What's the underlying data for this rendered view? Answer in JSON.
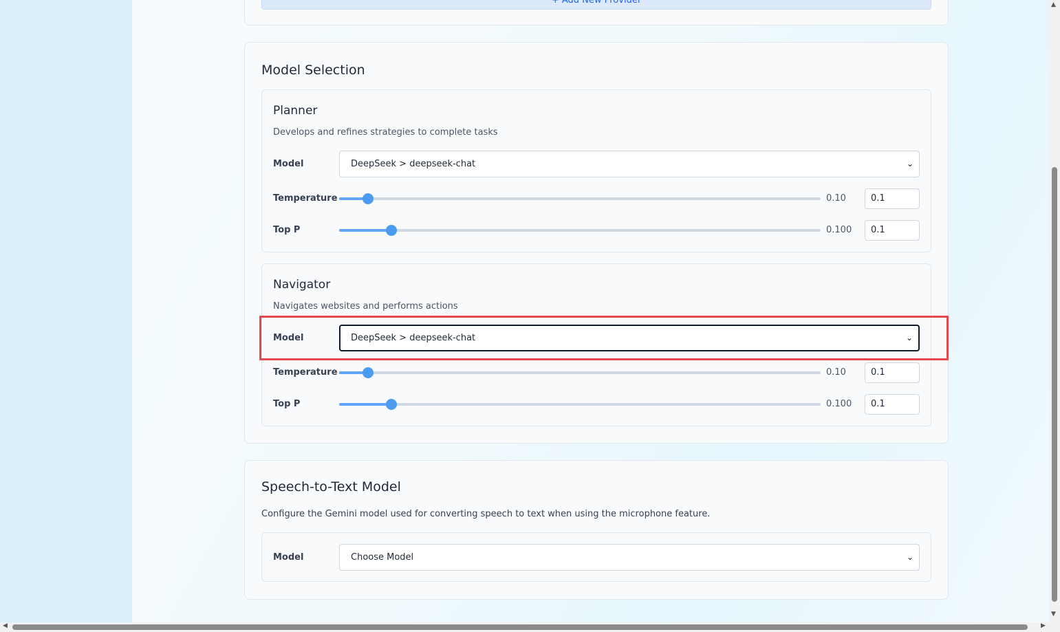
{
  "providers": {
    "add_button_label": "+ Add New Provider"
  },
  "model_selection": {
    "title": "Model Selection",
    "agents": [
      {
        "title": "Planner",
        "description": "Develops and refines strategies to complete tasks",
        "model_label": "Model",
        "model_value": "DeepSeek > deepseek-chat",
        "temperature": {
          "label": "Temperature",
          "value": 0.1,
          "display": "0.10",
          "input": "0.1",
          "fraction": 0.06
        },
        "top_p": {
          "label": "Top P",
          "value": 0.1,
          "display": "0.100",
          "input": "0.1",
          "fraction": 0.109
        }
      },
      {
        "title": "Navigator",
        "description": "Navigates websites and performs actions",
        "model_label": "Model",
        "model_value": "DeepSeek > deepseek-chat",
        "temperature": {
          "label": "Temperature",
          "value": 0.1,
          "display": "0.10",
          "input": "0.1",
          "fraction": 0.06
        },
        "top_p": {
          "label": "Top P",
          "value": 0.1,
          "display": "0.100",
          "input": "0.1",
          "fraction": 0.109
        }
      }
    ]
  },
  "speech_to_text": {
    "title": "Speech-to-Text Model",
    "description": "Configure the Gemini model used for converting speech to text when using the microphone feature.",
    "model_label": "Model",
    "model_value": "Choose Model"
  },
  "icons": {
    "select_chevron": "chevron-down-icon"
  },
  "colors": {
    "accent": "#60a5fa",
    "highlight": "#e5484d"
  }
}
